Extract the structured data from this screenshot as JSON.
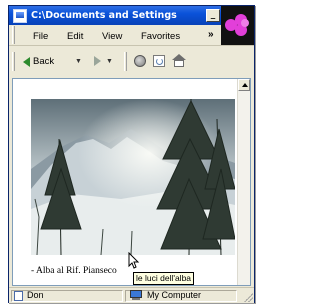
{
  "window": {
    "title": "C:\\Documents and Settings",
    "controls": {
      "minimize": "_",
      "maximize": "□",
      "close": "×"
    }
  },
  "menubar": {
    "items": [
      "File",
      "Edit",
      "View",
      "Favorites"
    ],
    "overflow": "»"
  },
  "toolbar": {
    "back_label": "Back",
    "icons": [
      "back-arrow-icon",
      "forward-arrow-icon",
      "stop-icon",
      "refresh-icon",
      "home-icon"
    ]
  },
  "content": {
    "caption": "- Alba al Rif. Pianseco",
    "tooltip": "le luci dell'alba"
  },
  "statusbar": {
    "left_text": "Don",
    "zone_text": "My Computer"
  },
  "colors": {
    "titlebar": "#0a52d9",
    "chrome": "#ece9d8",
    "tooltip_bg": "#ffffe1",
    "logo_accent": "#e23fd9"
  }
}
